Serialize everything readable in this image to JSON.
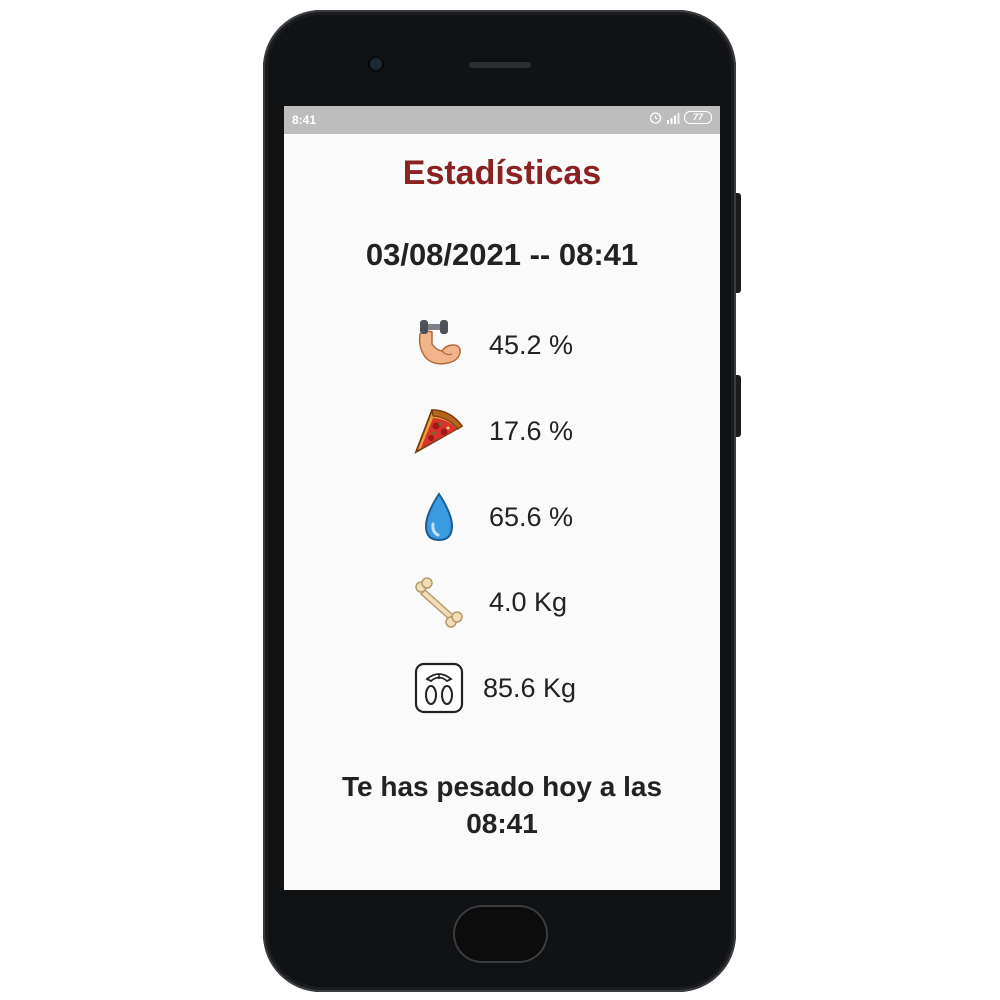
{
  "status_bar": {
    "time": "8:41",
    "battery": "77"
  },
  "screen": {
    "title": "Estadísticas",
    "datetime": "03/08/2021 -- 08:41",
    "metrics": [
      {
        "icon": "muscle-dumbbell-icon",
        "value": "45.2 %"
      },
      {
        "icon": "pizza-slice-icon",
        "value": "17.6 %"
      },
      {
        "icon": "water-drop-icon",
        "value": "65.6 %"
      },
      {
        "icon": "bone-icon",
        "value": "4.0 Kg"
      },
      {
        "icon": "scale-icon",
        "value": "85.6 Kg"
      }
    ],
    "footer_line1": "Te has pesado hoy a las",
    "footer_line2": "08:41"
  },
  "colors": {
    "title": "#8b2222",
    "statusbar": "#bdbdbd"
  }
}
